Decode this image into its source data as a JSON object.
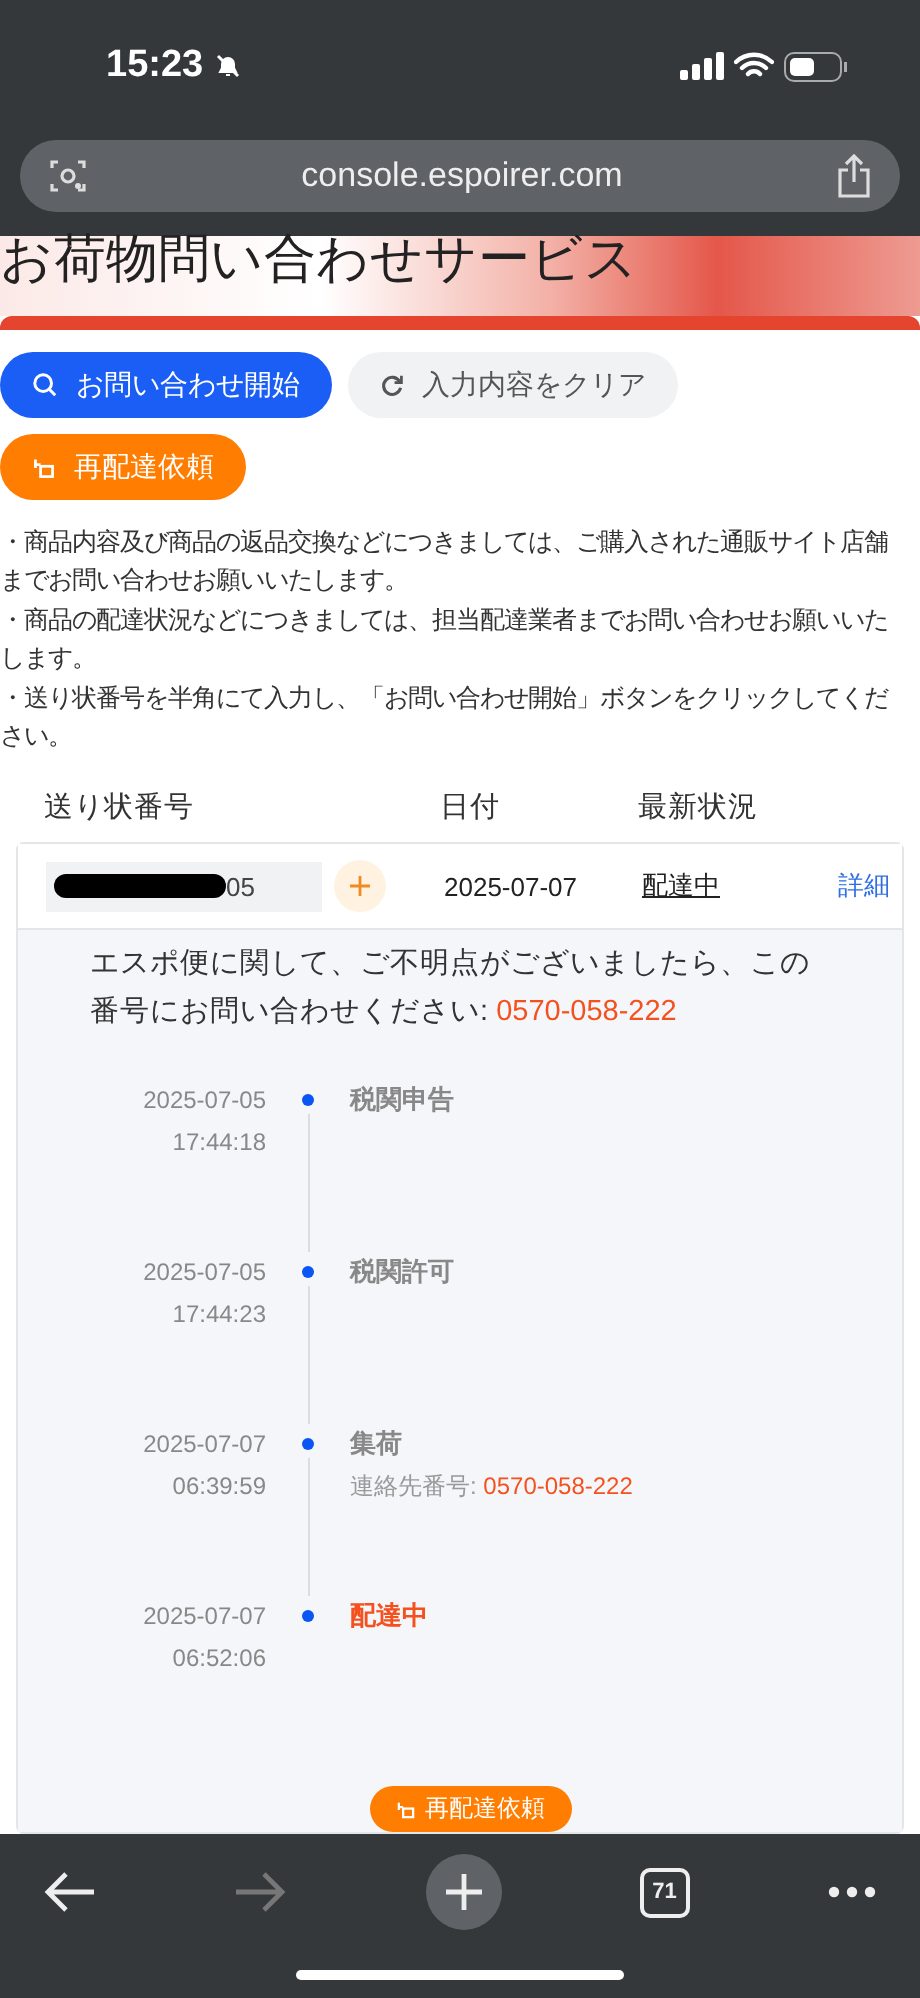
{
  "status_bar": {
    "time": "15:23",
    "silent": true
  },
  "browser": {
    "url": "console.espoirer.com",
    "tab_count": "71",
    "forward_disabled": true
  },
  "page": {
    "title": "お荷物問い合わせサービス",
    "buttons": [
      {
        "kind": "primary",
        "label": "お問い合わせ開始"
      },
      {
        "kind": "secondary",
        "label": "入力内容をクリア"
      },
      {
        "kind": "warning",
        "label": "再配達依頼"
      }
    ],
    "notes": [
      "・商品内容及び商品の返品交換などにつきましては、ご購入された通販サイト店舗までお問い合わせお願いいたします。",
      "・商品の配達状況などにつきましては、担当配達業者までお問い合わせお願いいたします。",
      "・送り状番号を半角にて入力し、「お問い合わせ開始」ボタンをクリックしてください。"
    ],
    "table": {
      "columns": [
        "送り状番号",
        "日付",
        "最新状況"
      ],
      "rows": [
        {
          "tracking_number": "05",
          "date": "2025-07-07",
          "status": "配達中",
          "detail": "詳細",
          "expanded": true,
          "info": "エスポ便に関して、ご不明点がございましたら、この番号にお問い合わせください: ",
          "info_phone": "0570-058-222",
          "events": [
            {
              "date": "2025-07-05",
              "time": "17:44:18",
              "title": "税関申告",
              "current": false
            },
            {
              "date": "2025-07-05",
              "time": "17:44:23",
              "title": "税関許可",
              "current": false
            },
            {
              "date": "2025-07-07",
              "time": "06:39:59",
              "title": "集荷",
              "current": false,
              "note": "連絡先番号: ",
              "phone": "0570-058-222"
            },
            {
              "date": "2025-07-07",
              "time": "06:52:06",
              "title": "配達中",
              "current": true
            }
          ],
          "redelivery_button": "再配達依頼"
        }
      ]
    }
  }
}
